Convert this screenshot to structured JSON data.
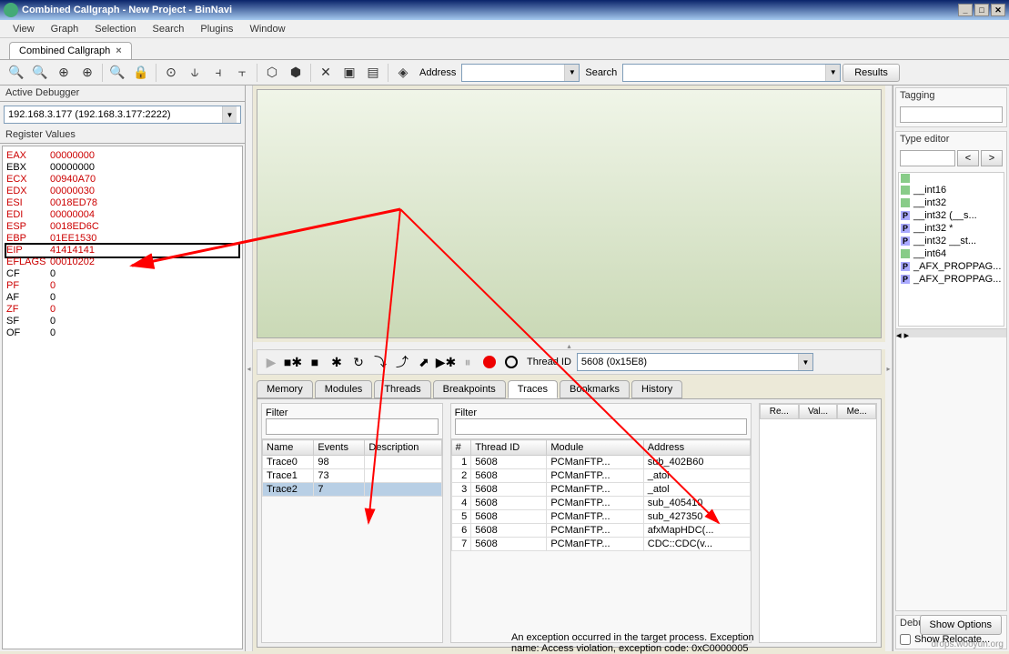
{
  "window": {
    "title": "Combined Callgraph - New Project - BinNavi"
  },
  "menu": {
    "items": [
      "View",
      "Graph",
      "Selection",
      "Search",
      "Plugins",
      "Window"
    ]
  },
  "tab": {
    "label": "Combined Callgraph",
    "close": "×"
  },
  "toolbar": {
    "address_label": "Address",
    "search_label": "Search",
    "results_label": "Results"
  },
  "debugger": {
    "panel_title": "Active Debugger",
    "selected": "192.168.3.177 (192.168.3.177:2222)"
  },
  "registers": {
    "panel_title": "Register Values",
    "rows": [
      {
        "n": "EAX",
        "v": "00000000",
        "red": true
      },
      {
        "n": "EBX",
        "v": "00000000",
        "red": false
      },
      {
        "n": "ECX",
        "v": "00940A70",
        "red": true
      },
      {
        "n": "EDX",
        "v": "00000030",
        "red": true
      },
      {
        "n": "ESI",
        "v": "0018ED78",
        "red": true
      },
      {
        "n": "EDI",
        "v": "00000004",
        "red": true
      },
      {
        "n": "ESP",
        "v": "0018ED6C",
        "red": true
      },
      {
        "n": "EBP",
        "v": "01EE1530",
        "red": true
      },
      {
        "n": "EIP",
        "v": "41414141",
        "red": true,
        "box": true
      },
      {
        "n": "EFLAGS",
        "v": "00010202",
        "red": true
      },
      {
        "n": "CF",
        "v": "0",
        "red": false
      },
      {
        "n": "PF",
        "v": "0",
        "red": true
      },
      {
        "n": "AF",
        "v": "0",
        "red": false
      },
      {
        "n": "ZF",
        "v": "0",
        "red": true
      },
      {
        "n": "SF",
        "v": "0",
        "red": false
      },
      {
        "n": "OF",
        "v": "0",
        "red": false
      }
    ]
  },
  "thread": {
    "label": "Thread ID",
    "value": "5608 (0x15E8)"
  },
  "lower_tabs": [
    "Memory",
    "Modules",
    "Threads",
    "Breakpoints",
    "Traces",
    "Bookmarks",
    "History"
  ],
  "active_lower_tab": "Traces",
  "trace_left": {
    "filter_label": "Filter",
    "headers": [
      "Name",
      "Events",
      "Description"
    ],
    "rows": [
      {
        "name": "Trace0",
        "events": "98",
        "desc": ""
      },
      {
        "name": "Trace1",
        "events": "73",
        "desc": ""
      },
      {
        "name": "Trace2",
        "events": "7",
        "desc": "",
        "selected": true
      }
    ]
  },
  "trace_right": {
    "filter_label": "Filter",
    "headers": [
      "#",
      "Thread ID",
      "Module",
      "Address"
    ],
    "rows": [
      {
        "n": "1",
        "tid": "5608",
        "mod": "PCManFTP...",
        "addr": "sub_402B60"
      },
      {
        "n": "2",
        "tid": "5608",
        "mod": "PCManFTP...",
        "addr": "_atoi"
      },
      {
        "n": "3",
        "tid": "5608",
        "mod": "PCManFTP...",
        "addr": "_atol"
      },
      {
        "n": "4",
        "tid": "5608",
        "mod": "PCManFTP...",
        "addr": "sub_405410"
      },
      {
        "n": "5",
        "tid": "5608",
        "mod": "PCManFTP...",
        "addr": "sub_427350"
      },
      {
        "n": "6",
        "tid": "5608",
        "mod": "PCManFTP...",
        "addr": "afxMapHDC(..."
      },
      {
        "n": "7",
        "tid": "5608",
        "mod": "PCManFTP...",
        "addr": "CDC::CDC(v..."
      }
    ]
  },
  "mini_cols": [
    "Re...",
    "Val...",
    "Me..."
  ],
  "right": {
    "tagging_title": "Tagging",
    "type_title": "Type editor",
    "type_btns": {
      "lt": "<",
      "gt": ">"
    },
    "types": [
      {
        "k": "g",
        "l": ""
      },
      {
        "k": "g",
        "l": "__int16"
      },
      {
        "k": "g",
        "l": "__int32"
      },
      {
        "k": "p",
        "l": "__int32 (__s..."
      },
      {
        "k": "p",
        "l": "__int32 *"
      },
      {
        "k": "p",
        "l": "__int32 __st..."
      },
      {
        "k": "g",
        "l": "__int64"
      },
      {
        "k": "p",
        "l": "_AFX_PROPPAG..."
      },
      {
        "k": "p",
        "l": "_AFX_PROPPAG..."
      }
    ],
    "debugger_opts_title": "Debugger Options",
    "show_relocate": "Show Relocate...",
    "show_options": "Show Options"
  },
  "status": "An exception occurred in the target process. Exception name: Access violation, exception code: 0xC0000005",
  "watermark": "drops.wooyun.org"
}
